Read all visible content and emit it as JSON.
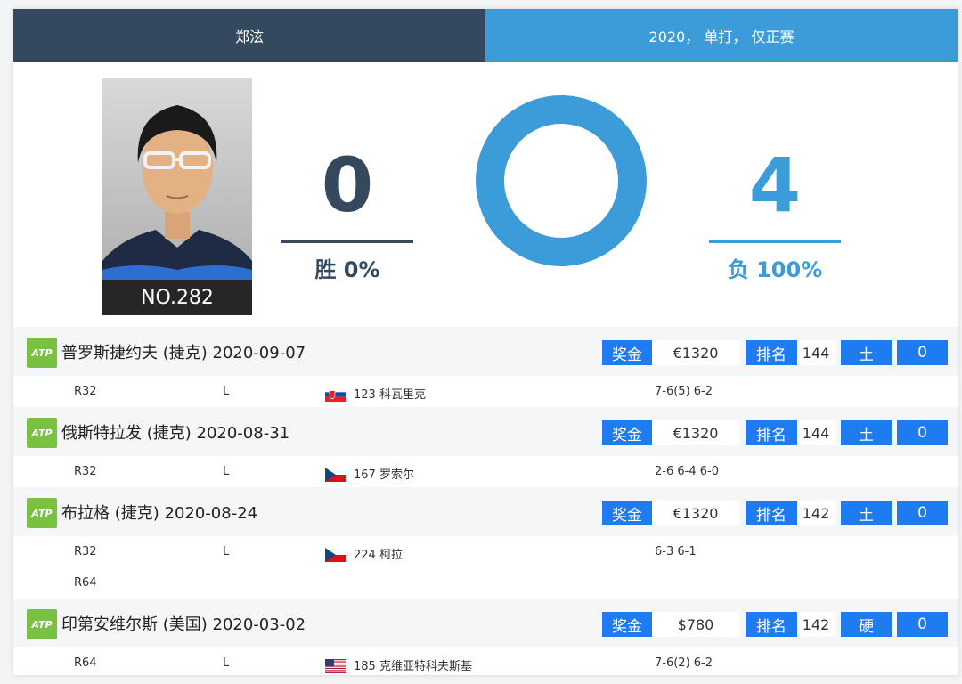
{
  "tabs": {
    "player": "郑泫",
    "filter": "2020， 单打， 仅正赛"
  },
  "profile": {
    "rank_label": "NO.282"
  },
  "stats": {
    "wins": "0",
    "win_label": "胜 0%",
    "losses": "4",
    "loss_label": "负 100%",
    "win_fraction": 0,
    "loss_fraction": 1
  },
  "colors": {
    "dark": "#34495e",
    "blue": "#3b9cd9",
    "button": "#1e7cf0",
    "atp_green": "#7ac143"
  },
  "labels": {
    "prize": "奖金",
    "rank": "排名",
    "atp": "ATP"
  },
  "tournaments": [
    {
      "title": "普罗斯捷约夫 (捷克) 2020-09-07",
      "prize": "€1320",
      "rank": "144",
      "surface": "土",
      "points": "0",
      "matches": [
        {
          "round": "R32",
          "result": "L",
          "flag": "svk-flag-icon",
          "opponent": "123 科瓦里克",
          "score": "7-6(5) 6-2"
        }
      ]
    },
    {
      "title": "俄斯特拉发 (捷克) 2020-08-31",
      "prize": "€1320",
      "rank": "144",
      "surface": "土",
      "points": "0",
      "matches": [
        {
          "round": "R32",
          "result": "L",
          "flag": "cze-flag-icon",
          "opponent": "167 罗索尔",
          "score": "2-6 6-4 6-0"
        }
      ]
    },
    {
      "title": "布拉格 (捷克) 2020-08-24",
      "prize": "€1320",
      "rank": "142",
      "surface": "土",
      "points": "0",
      "matches": [
        {
          "round": "R32",
          "result": "L",
          "flag": "cze-flag-icon",
          "opponent": "224 柯拉",
          "score": "6-3 6-1"
        },
        {
          "round": "R64",
          "result": "",
          "flag": "",
          "opponent": "",
          "score": ""
        }
      ]
    },
    {
      "title": "印第安维尔斯 (美国) 2020-03-02",
      "prize": "$780",
      "rank": "142",
      "surface": "硬",
      "points": "0",
      "matches": [
        {
          "round": "R64",
          "result": "L",
          "flag": "usa-flag-icon",
          "opponent": "185 克维亚特科夫斯基",
          "score": "7-6(2) 6-2"
        }
      ]
    }
  ]
}
